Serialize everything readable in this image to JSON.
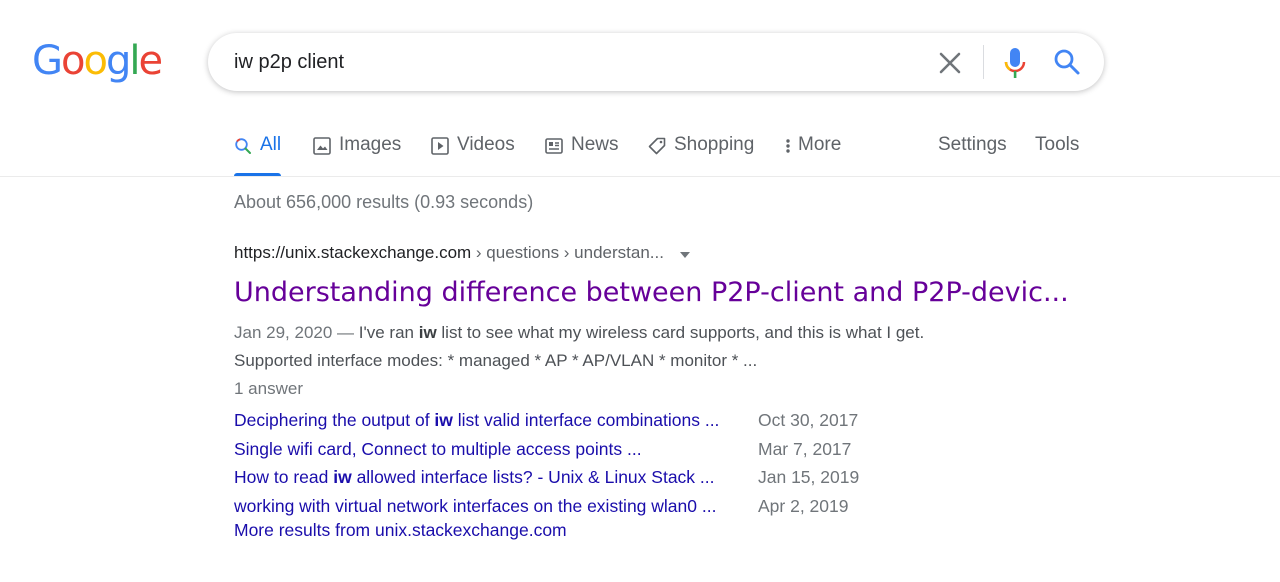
{
  "logo": {
    "text": "Google",
    "letters": [
      "G",
      "o",
      "o",
      "g",
      "l",
      "e"
    ],
    "colors": [
      "#4285F4",
      "#EA4335",
      "#FBBC05",
      "#4285F4",
      "#34A853",
      "#EA4335"
    ]
  },
  "search": {
    "query": "iw p2p client"
  },
  "tabs": [
    {
      "label": "All",
      "icon": "search-icon"
    },
    {
      "label": "Images",
      "icon": "image-icon"
    },
    {
      "label": "Videos",
      "icon": "play-icon"
    },
    {
      "label": "News",
      "icon": "newspaper-icon"
    },
    {
      "label": "Shopping",
      "icon": "tag-icon"
    },
    {
      "label": "More",
      "icon": "dots-vertical-icon"
    }
  ],
  "settings_label": "Settings",
  "tools_label": "Tools",
  "stats": "About 656,000 results (0.93 seconds)",
  "result": {
    "domain": "https://unix.stackexchange.com",
    "path": " › questions › understan...",
    "title": "Understanding difference between P2P-client and P2P-devic...",
    "snippet_date": "Jan 29, 2020",
    "snippet_sep": " — ",
    "snippet_pre": "I've ran ",
    "snippet_bold": "iw",
    "snippet_post": " list to see what my wireless card supports, and this is what I get.",
    "snippet_line2": "Supported interface modes: * managed * AP * AP/VLAN * monitor * ...",
    "answers": "1 answer"
  },
  "sitelinks": [
    {
      "pre": "Deciphering the output of ",
      "bold": "iw",
      "post": " list valid interface combinations ...",
      "date": "Oct 30, 2017"
    },
    {
      "pre": "Single wifi card, Connect to multiple access points ...",
      "bold": "",
      "post": "",
      "date": "Mar 7, 2017"
    },
    {
      "pre": "How to read ",
      "bold": "iw",
      "post": " allowed interface lists? - Unix & Linux Stack ...",
      "date": "Jan 15, 2019"
    },
    {
      "pre": "working with virtual network interfaces on the existing wlan0 ...",
      "bold": "",
      "post": "",
      "date": "Apr 2, 2019"
    }
  ],
  "more_results": "More results from unix.stackexchange.com",
  "colors": {
    "link": "#1a0dab",
    "visited": "#660099",
    "accent": "#1a73e8"
  }
}
